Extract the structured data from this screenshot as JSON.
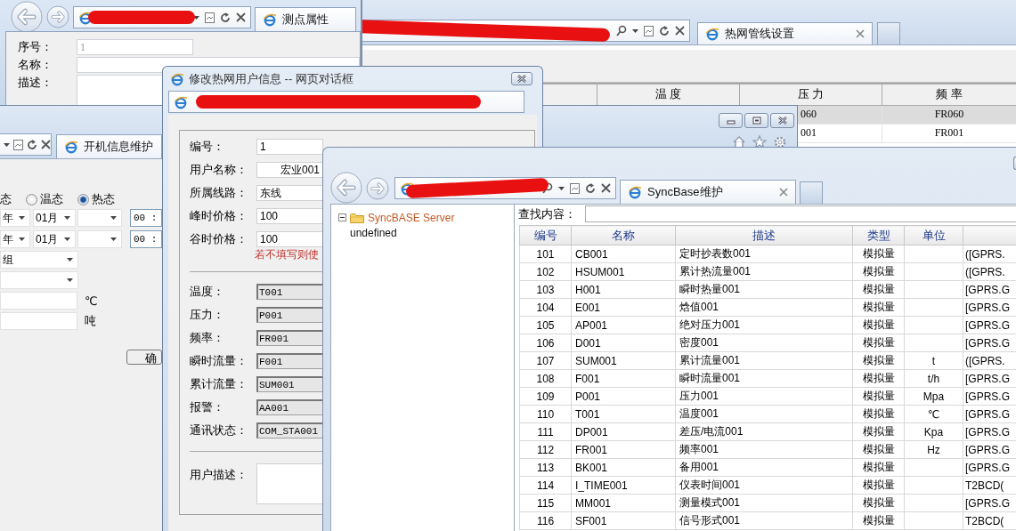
{
  "point_properties_window": {
    "tab_title": "测点属性",
    "fields": [
      {
        "label": "序号：",
        "value": "1",
        "disabled": true,
        "kind": "text"
      },
      {
        "label": "名称：",
        "kind": "text"
      },
      {
        "label": "描述：",
        "kind": "textarea"
      }
    ]
  },
  "pipeline_window": {
    "tab_title": "热网管线设置",
    "table": {
      "columns": [
        "温 度",
        "压 力",
        "频 率"
      ],
      "rows": [
        {
          "pressure": "060",
          "frequency": "FR060",
          "selected": true
        },
        {
          "pressure": "001",
          "frequency": "FR001",
          "selected": false
        }
      ]
    }
  },
  "startup_window": {
    "tab_title": "开机信息维护",
    "state_label": "态",
    "radios": [
      {
        "label": "温态",
        "selected": false
      },
      {
        "label": "热态",
        "selected": true
      }
    ],
    "date_rows": [
      {
        "year": "年",
        "month": "01月",
        "time": "00 :"
      },
      {
        "year": "年",
        "month": "01月",
        "time": "00 :"
      }
    ],
    "selects": [
      {
        "kind": "text",
        "value": "组"
      },
      {
        "kind": "blank"
      }
    ],
    "inputs": [
      {
        "unit": "℃"
      },
      {
        "unit": "吨"
      }
    ],
    "button": "确"
  },
  "user_dialog": {
    "title": "修改热网用户信息 -- 网页对话框",
    "fields": [
      {
        "label": "编号：",
        "value": "1"
      },
      {
        "label": "用户名称：",
        "value": "宏业001"
      },
      {
        "label": "所属线路：",
        "value": "东线"
      },
      {
        "label": "峰时价格：",
        "value": "100"
      },
      {
        "label": "谷时价格：",
        "value": "100"
      }
    ],
    "hint": "若不填写则使",
    "point_fields": [
      {
        "label": "温度：",
        "value": "T001"
      },
      {
        "label": "压力：",
        "value": "P001"
      },
      {
        "label": "频率：",
        "value": "FR001"
      },
      {
        "label": "瞬时流量：",
        "value": "F001"
      },
      {
        "label": "累计流量：",
        "value": "SUM001"
      },
      {
        "label": "报警：",
        "value": "AA001"
      },
      {
        "label": "通讯状态：",
        "value": "COM_STA001"
      }
    ],
    "description_label": "用户描述："
  },
  "syncbase_window": {
    "tab_title": "SyncBase维护",
    "tree": [
      {
        "label": "SyncBASE Server",
        "expanded": true,
        "children": [
          {
            "label": "undefined"
          }
        ]
      }
    ],
    "search_label": "查找内容：",
    "table": {
      "columns": [
        "编号",
        "名称",
        "描述",
        "类型",
        "单位"
      ],
      "rows": [
        {
          "id": "101",
          "name": "CB001",
          "description": "定时抄表数001",
          "type": "模拟量",
          "column_6": "([GPRS."
        },
        {
          "id": "102",
          "name": "HSUM001",
          "description": "累计热流量001",
          "type": "模拟量",
          "column_6": "([GPRS."
        },
        {
          "id": "103",
          "name": "H001",
          "description": "瞬时热量001",
          "type": "模拟量",
          "column_6": "[GPRS.G"
        },
        {
          "id": "104",
          "name": "E001",
          "description": "焓值001",
          "type": "模拟量",
          "column_6": "[GPRS.G"
        },
        {
          "id": "105",
          "name": "AP001",
          "description": "绝对压力001",
          "type": "模拟量",
          "column_6": "[GPRS.G"
        },
        {
          "id": "106",
          "name": "D001",
          "description": "密度001",
          "type": "模拟量",
          "column_6": "[GPRS.G"
        },
        {
          "id": "107",
          "name": "SUM001",
          "description": "累计流量001",
          "type": "模拟量",
          "unit": "t",
          "column_6": "([GPRS."
        },
        {
          "id": "108",
          "name": "F001",
          "description": "瞬时流量001",
          "type": "模拟量",
          "unit": "t/h",
          "column_6": "[GPRS.G"
        },
        {
          "id": "109",
          "name": "P001",
          "description": "压力001",
          "type": "模拟量",
          "unit": "Mpa",
          "column_6": "[GPRS.G"
        },
        {
          "id": "110",
          "name": "T001",
          "description": "温度001",
          "type": "模拟量",
          "unit": "℃",
          "column_6": "[GPRS.G"
        },
        {
          "id": "111",
          "name": "DP001",
          "description": "差压/电流001",
          "type": "模拟量",
          "unit": "Kpa",
          "column_6": "[GPRS.G"
        },
        {
          "id": "112",
          "name": "FR001",
          "description": "频率001",
          "type": "模拟量",
          "unit": "Hz",
          "column_6": "[GPRS.G"
        },
        {
          "id": "113",
          "name": "BK001",
          "description": "备用001",
          "type": "模拟量",
          "column_6": "[GPRS.G"
        },
        {
          "id": "114",
          "name": "I_TIME001",
          "description": "仪表时间001",
          "type": "模拟量",
          "column_6": "T2BCD("
        },
        {
          "id": "115",
          "name": "MM001",
          "description": "测量模式001",
          "type": "模拟量",
          "column_6": "[GPRS.G"
        },
        {
          "id": "116",
          "name": "SF001",
          "description": "信号形式001",
          "type": "模拟量",
          "column_6": "T2BCD("
        }
      ]
    }
  }
}
